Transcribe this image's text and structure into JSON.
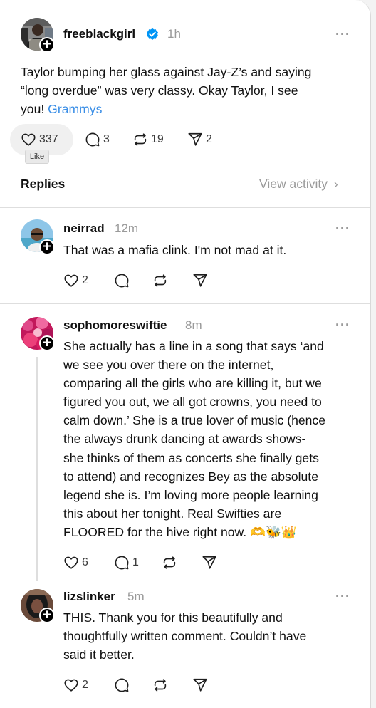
{
  "main_post": {
    "username": "freeblackgirl",
    "verified": true,
    "time": "1h",
    "body_lines": [
      "Taylor bumping her glass against Jay-Z’s and saying",
      "“long overdue” was very classy. Okay Taylor, I see",
      "you!"
    ],
    "tag": "Grammys",
    "likes": "337",
    "replies": "3",
    "reposts": "19",
    "shares": "2",
    "tooltip": "Like"
  },
  "replies_header": {
    "title": "Replies",
    "view_activity": "View activity"
  },
  "replies": [
    {
      "username": "neirrad",
      "time": "12m",
      "lines": [
        "That was a mafia clink. I'm not mad at it."
      ],
      "likes": "2"
    },
    {
      "username": "sophomoreswiftie",
      "time": "8m",
      "lines": [
        "She actually has a line in a song that says ‘and",
        "we see you over there on the internet,",
        "comparing all the girls who are killing it, but we",
        "figured you out, we all got crowns, you need to",
        "calm down.’ She is a true lover of music (hence",
        "the always drunk dancing at awards shows-",
        "she thinks of them as concerts she finally gets",
        "to attend) and recognizes Bey as the absolute",
        "legend she is. I’m loving more people learning",
        "this about her tonight. Real Swifties are",
        "FLOORED for the hive right now. 🫶🐝👑"
      ],
      "likes": "6",
      "replies": "1"
    },
    {
      "username": "lizslinker",
      "time": "5m",
      "lines": [
        "THIS. Thank you for this beautifully and",
        "thoughtfully written comment. Couldn’t have",
        "said it better."
      ],
      "likes": "2"
    }
  ],
  "colors": {
    "link": "#3a8ee6",
    "verified": "#0095f6",
    "muted": "#9a9a9a"
  }
}
